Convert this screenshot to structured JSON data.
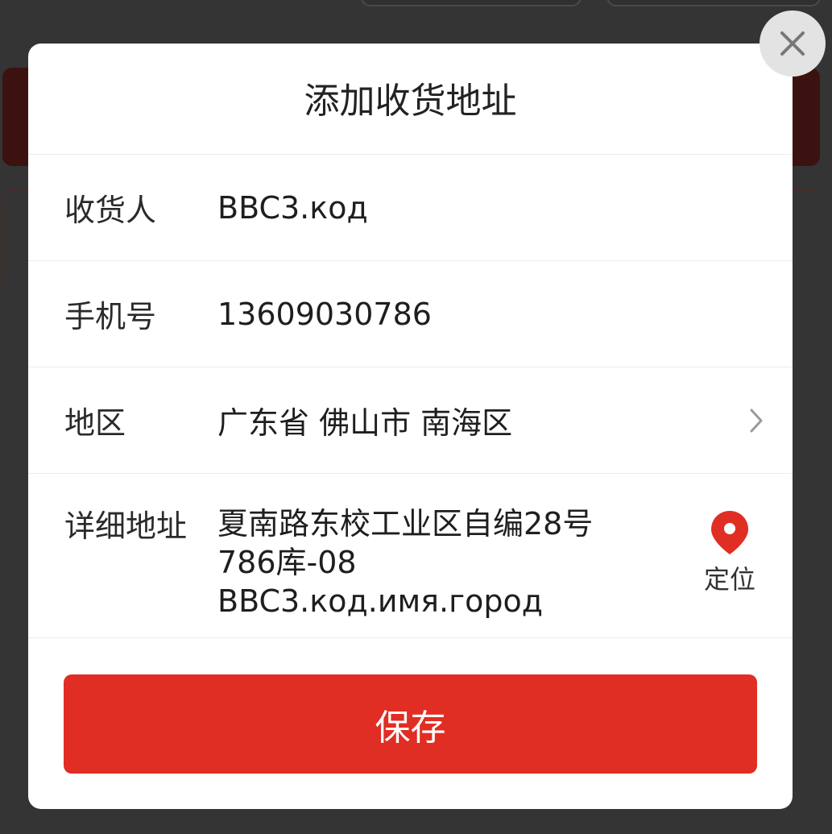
{
  "dialog": {
    "title": "添加收货地址",
    "fields": {
      "recipient": {
        "label": "收货人",
        "value": "BBC3.код"
      },
      "phone": {
        "label": "手机号",
        "value": "13609030786"
      },
      "region": {
        "label": "地区",
        "value": "广东省 佛山市 南海区",
        "icon": "chevron-right-icon"
      },
      "address": {
        "label": "详细地址",
        "value": "夏南路东校工业区自编28号\n786库-08\nBBC3.код.имя.город"
      }
    },
    "locate": {
      "label": "定位",
      "icon": "map-pin-icon"
    },
    "save_label": "保存",
    "close_icon": "close-icon"
  },
  "colors": {
    "accent": "#e02e24",
    "overlay": "#343434"
  }
}
